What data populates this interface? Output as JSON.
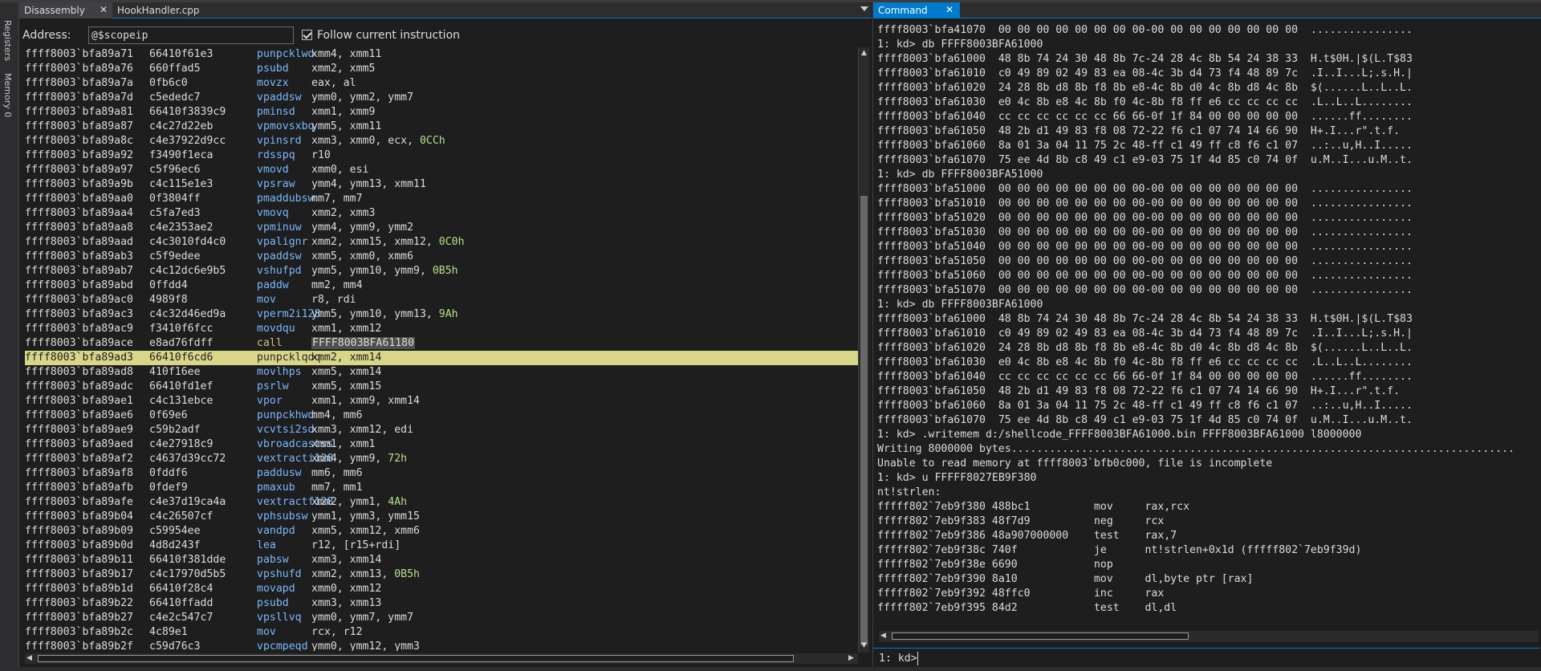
{
  "sidebar": {
    "registers_label": "Registers",
    "memory_label": "Memory 0"
  },
  "left_panel": {
    "tabs": [
      {
        "label": "Disassembly"
      },
      {
        "label": "HookHandler.cpp"
      }
    ],
    "address_label": "Address:",
    "address_value": "@$scopeip",
    "follow_label": "Follow current instruction",
    "follow_checked": true,
    "rows": [
      {
        "addr": "ffff8003`bfa89a71",
        "bytes": "66410f61e3",
        "mn": "punpcklwd",
        "op": "xmm4, xmm11"
      },
      {
        "addr": "ffff8003`bfa89a76",
        "bytes": "660ffad5",
        "mn": "psubd",
        "op": "xmm2, xmm5"
      },
      {
        "addr": "ffff8003`bfa89a7a",
        "bytes": "0fb6c0",
        "mn": "movzx",
        "op": "eax, al"
      },
      {
        "addr": "ffff8003`bfa89a7d",
        "bytes": "c5ededc7",
        "mn": "vpaddsw",
        "op": "ymm0, ymm2, ymm7"
      },
      {
        "addr": "ffff8003`bfa89a81",
        "bytes": "66410f3839c9",
        "mn": "pminsd",
        "op": "xmm1, xmm9"
      },
      {
        "addr": "ffff8003`bfa89a87",
        "bytes": "c4c27d22eb",
        "mn": "vpmovsxbq",
        "op": "ymm5, xmm11"
      },
      {
        "addr": "ffff8003`bfa89a8c",
        "bytes": "c4e37922d9cc",
        "mn": "vpinsrd",
        "op": "xmm3, xmm0, ecx, ",
        "num": "0CCh"
      },
      {
        "addr": "ffff8003`bfa89a92",
        "bytes": "f3490f1eca",
        "mn": "rdsspq",
        "op": "r10"
      },
      {
        "addr": "ffff8003`bfa89a97",
        "bytes": "c5f96ec6",
        "mn": "vmovd",
        "op": "xmm0, esi"
      },
      {
        "addr": "ffff8003`bfa89a9b",
        "bytes": "c4c115e1e3",
        "mn": "vpsraw",
        "op": "ymm4, ymm13, xmm11"
      },
      {
        "addr": "ffff8003`bfa89aa0",
        "bytes": "0f3804ff",
        "mn": "pmaddubsw",
        "op": "mm7, mm7"
      },
      {
        "addr": "ffff8003`bfa89aa4",
        "bytes": "c5fa7ed3",
        "mn": "vmovq",
        "op": "xmm2, xmm3"
      },
      {
        "addr": "ffff8003`bfa89aa8",
        "bytes": "c4e2353ae2",
        "mn": "vpminuw",
        "op": "ymm4, ymm9, ymm2"
      },
      {
        "addr": "ffff8003`bfa89aad",
        "bytes": "c4c3010fd4c0",
        "mn": "vpalignr",
        "op": "xmm2, xmm15, xmm12, ",
        "num": "0C0h"
      },
      {
        "addr": "ffff8003`bfa89ab3",
        "bytes": "c5f9edee",
        "mn": "vpaddsw",
        "op": "xmm5, xmm0, xmm6"
      },
      {
        "addr": "ffff8003`bfa89ab7",
        "bytes": "c4c12dc6e9b5",
        "mn": "vshufpd",
        "op": "ymm5, ymm10, ymm9, ",
        "num": "0B5h"
      },
      {
        "addr": "ffff8003`bfa89abd",
        "bytes": "0ffdd4",
        "mn": "paddw",
        "op": "mm2, mm4"
      },
      {
        "addr": "ffff8003`bfa89ac0",
        "bytes": "4989f8",
        "mn": "mov",
        "op": "r8, rdi"
      },
      {
        "addr": "ffff8003`bfa89ac3",
        "bytes": "c4c32d46ed9a",
        "mn": "vperm2i128",
        "op": "ymm5, ymm10, ymm13, ",
        "num": "9Ah"
      },
      {
        "addr": "ffff8003`bfa89ac9",
        "bytes": "f3410f6fcc",
        "mn": "movdqu",
        "op": "xmm1, xmm12"
      },
      {
        "addr": "ffff8003`bfa89ace",
        "bytes": "e8ad76fdff",
        "mn": "call",
        "call": "FFFF8003BFA61180"
      },
      {
        "addr": "ffff8003`bfa89ad3",
        "bytes": "66410f6cd6",
        "mn": "punpcklqdq",
        "op": "xmm2, xmm14",
        "hl": true
      },
      {
        "addr": "ffff8003`bfa89ad8",
        "bytes": "410f16ee",
        "mn": "movlhps",
        "op": "xmm5, xmm14"
      },
      {
        "addr": "ffff8003`bfa89adc",
        "bytes": "66410fd1ef",
        "mn": "psrlw",
        "op": "xmm5, xmm15"
      },
      {
        "addr": "ffff8003`bfa89ae1",
        "bytes": "c4c131ebce",
        "mn": "vpor",
        "op": "xmm1, xmm9, xmm14"
      },
      {
        "addr": "ffff8003`bfa89ae6",
        "bytes": "0f69e6",
        "mn": "punpckhwd",
        "op": "mm4, mm6"
      },
      {
        "addr": "ffff8003`bfa89ae9",
        "bytes": "c59b2adf",
        "mn": "vcvtsi2sd",
        "op": "xmm3, xmm12, edi"
      },
      {
        "addr": "ffff8003`bfa89aed",
        "bytes": "c4e27918c9",
        "mn": "vbroadcastss",
        "op": "xmm1, xmm1"
      },
      {
        "addr": "ffff8003`bfa89af2",
        "bytes": "c4637d39cc72",
        "mn": "vextracti128",
        "op": "xmm4, ymm9, ",
        "num": "72h"
      },
      {
        "addr": "ffff8003`bfa89af8",
        "bytes": "0fddf6",
        "mn": "paddusw",
        "op": "mm6, mm6"
      },
      {
        "addr": "ffff8003`bfa89afb",
        "bytes": "0fdef9",
        "mn": "pmaxub",
        "op": "mm7, mm1"
      },
      {
        "addr": "ffff8003`bfa89afe",
        "bytes": "c4e37d19ca4a",
        "mn": "vextractf128",
        "op": "xmm2, ymm1, ",
        "num": "4Ah"
      },
      {
        "addr": "ffff8003`bfa89b04",
        "bytes": "c4c26507cf",
        "mn": "vphsubsw",
        "op": "ymm1, ymm3, ymm15"
      },
      {
        "addr": "ffff8003`bfa89b09",
        "bytes": "c59954ee",
        "mn": "vandpd",
        "op": "xmm5, xmm12, xmm6"
      },
      {
        "addr": "ffff8003`bfa89b0d",
        "bytes": "4d8d243f",
        "mn": "lea",
        "op": "r12, [r15+rdi]"
      },
      {
        "addr": "ffff8003`bfa89b11",
        "bytes": "66410f381dde",
        "mn": "pabsw",
        "op": "xmm3, xmm14"
      },
      {
        "addr": "ffff8003`bfa89b17",
        "bytes": "c4c17970d5b5",
        "mn": "vpshufd",
        "op": "xmm2, xmm13, ",
        "num": "0B5h"
      },
      {
        "addr": "ffff8003`bfa89b1d",
        "bytes": "66410f28c4",
        "mn": "movapd",
        "op": "xmm0, xmm12"
      },
      {
        "addr": "ffff8003`bfa89b22",
        "bytes": "66410ffadd",
        "mn": "psubd",
        "op": "xmm3, xmm13"
      },
      {
        "addr": "ffff8003`bfa89b27",
        "bytes": "c4e2c547c7",
        "mn": "vpsllvq",
        "op": "ymm0, ymm7, ymm7"
      },
      {
        "addr": "ffff8003`bfa89b2c",
        "bytes": "4c89e1",
        "mn": "mov",
        "op": "rcx, r12"
      },
      {
        "addr": "ffff8003`bfa89b2f",
        "bytes": "c59d76c3",
        "mn": "vpcmpeqd",
        "op": "ymm0, ymm12, ymm3"
      }
    ]
  },
  "right_panel": {
    "tab_label": "Command",
    "prompt": "1: kd>",
    "lines": [
      "ffff8003`bfa41070  00 00 00 00 00 00 00 00-00 00 00 00 00 00 00 00  ................",
      "1: kd> db FFFF8003BFA61000",
      "ffff8003`bfa61000  48 8b 74 24 30 48 8b 7c-24 28 4c 8b 54 24 38 33  H.t$0H.|$(L.T$83",
      "ffff8003`bfa61010  c0 49 89 02 49 83 ea 08-4c 3b d4 73 f4 48 89 7c  .I..I...L;.s.H.|",
      "ffff8003`bfa61020  24 28 8b d8 8b f8 8b e8-4c 8b d0 4c 8b d8 4c 8b  $(......L..L..L.",
      "ffff8003`bfa61030  e0 4c 8b e8 4c 8b f0 4c-8b f8 ff e6 cc cc cc cc  .L..L..L........",
      "ffff8003`bfa61040  cc cc cc cc cc cc 66 66-0f 1f 84 00 00 00 00 00  ......ff........",
      "ffff8003`bfa61050  48 2b d1 49 83 f8 08 72-22 f6 c1 07 74 14 66 90  H+.I...r\".t.f.",
      "ffff8003`bfa61060  8a 01 3a 04 11 75 2c 48-ff c1 49 ff c8 f6 c1 07  ..:..u,H..I.....",
      "ffff8003`bfa61070  75 ee 4d 8b c8 49 c1 e9-03 75 1f 4d 85 c0 74 0f  u.M..I...u.M..t.",
      "1: kd> db FFFF8003BFA51000",
      "ffff8003`bfa51000  00 00 00 00 00 00 00 00-00 00 00 00 00 00 00 00  ................",
      "ffff8003`bfa51010  00 00 00 00 00 00 00 00-00 00 00 00 00 00 00 00  ................",
      "ffff8003`bfa51020  00 00 00 00 00 00 00 00-00 00 00 00 00 00 00 00  ................",
      "ffff8003`bfa51030  00 00 00 00 00 00 00 00-00 00 00 00 00 00 00 00  ................",
      "ffff8003`bfa51040  00 00 00 00 00 00 00 00-00 00 00 00 00 00 00 00  ................",
      "ffff8003`bfa51050  00 00 00 00 00 00 00 00-00 00 00 00 00 00 00 00  ................",
      "ffff8003`bfa51060  00 00 00 00 00 00 00 00-00 00 00 00 00 00 00 00  ................",
      "ffff8003`bfa51070  00 00 00 00 00 00 00 00-00 00 00 00 00 00 00 00  ................",
      "1: kd> db FFFF8003BFA61000",
      "ffff8003`bfa61000  48 8b 74 24 30 48 8b 7c-24 28 4c 8b 54 24 38 33  H.t$0H.|$(L.T$83",
      "ffff8003`bfa61010  c0 49 89 02 49 83 ea 08-4c 3b d4 73 f4 48 89 7c  .I..I...L;.s.H.|",
      "ffff8003`bfa61020  24 28 8b d8 8b f8 8b e8-4c 8b d0 4c 8b d8 4c 8b  $(......L..L..L.",
      "ffff8003`bfa61030  e0 4c 8b e8 4c 8b f0 4c-8b f8 ff e6 cc cc cc cc  .L..L..L........",
      "ffff8003`bfa61040  cc cc cc cc cc cc 66 66-0f 1f 84 00 00 00 00 00  ......ff........",
      "ffff8003`bfa61050  48 2b d1 49 83 f8 08 72-22 f6 c1 07 74 14 66 90  H+.I...r\".t.f.",
      "ffff8003`bfa61060  8a 01 3a 04 11 75 2c 48-ff c1 49 ff c8 f6 c1 07  ..:..u,H..I.....",
      "ffff8003`bfa61070  75 ee 4d 8b c8 49 c1 e9-03 75 1f 4d 85 c0 74 0f  u.M..I...u.M..t.",
      "1: kd> .writemem d:/shellcode_FFFF8003BFA61000.bin FFFF8003BFA61000 l8000000",
      "Writing 8000000 bytes...............................................................................................",
      "Unable to read memory at ffff8003`bfb0c000, file is incomplete",
      "1: kd> u FFFFF8027EB9F380",
      "nt!strlen:",
      "fffff802`7eb9f380 488bc1          mov     rax,rcx",
      "fffff802`7eb9f383 48f7d9          neg     rcx",
      "fffff802`7eb9f386 48a907000000    test    rax,7",
      "fffff802`7eb9f38c 740f            je      nt!strlen+0x1d (fffff802`7eb9f39d)",
      "fffff802`7eb9f38e 6690            nop",
      "fffff802`7eb9f390 8a10            mov     dl,byte ptr [rax]",
      "fffff802`7eb9f392 48ffc0          inc     rax",
      "fffff802`7eb9f395 84d2            test    dl,dl"
    ]
  }
}
